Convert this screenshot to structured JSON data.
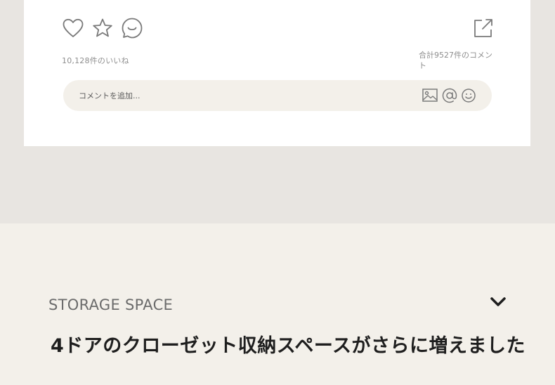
{
  "post_actions": {
    "like_icon": "heart-icon",
    "favorite_icon": "star-icon",
    "comment_icon": "speech-bubble-icon",
    "share_icon": "share-external-icon"
  },
  "stats": {
    "likes_text": "10,128件のいいね",
    "comments_text": "合計9527件のコメント"
  },
  "comment_box": {
    "placeholder": "コメントを追加...",
    "image_icon": "image-icon",
    "mention_icon": "at-icon",
    "emoji_icon": "smiley-icon"
  },
  "section": {
    "label": "STORAGE SPACE",
    "toggle_icon": "chevron-down-icon",
    "headline": "4ドアのクローゼット収納スペースがさらに増えました"
  },
  "colors": {
    "band": "#e8e5e1",
    "card": "#ffffff",
    "cream": "#f3f0ea",
    "icon": "#7a7a7a"
  }
}
